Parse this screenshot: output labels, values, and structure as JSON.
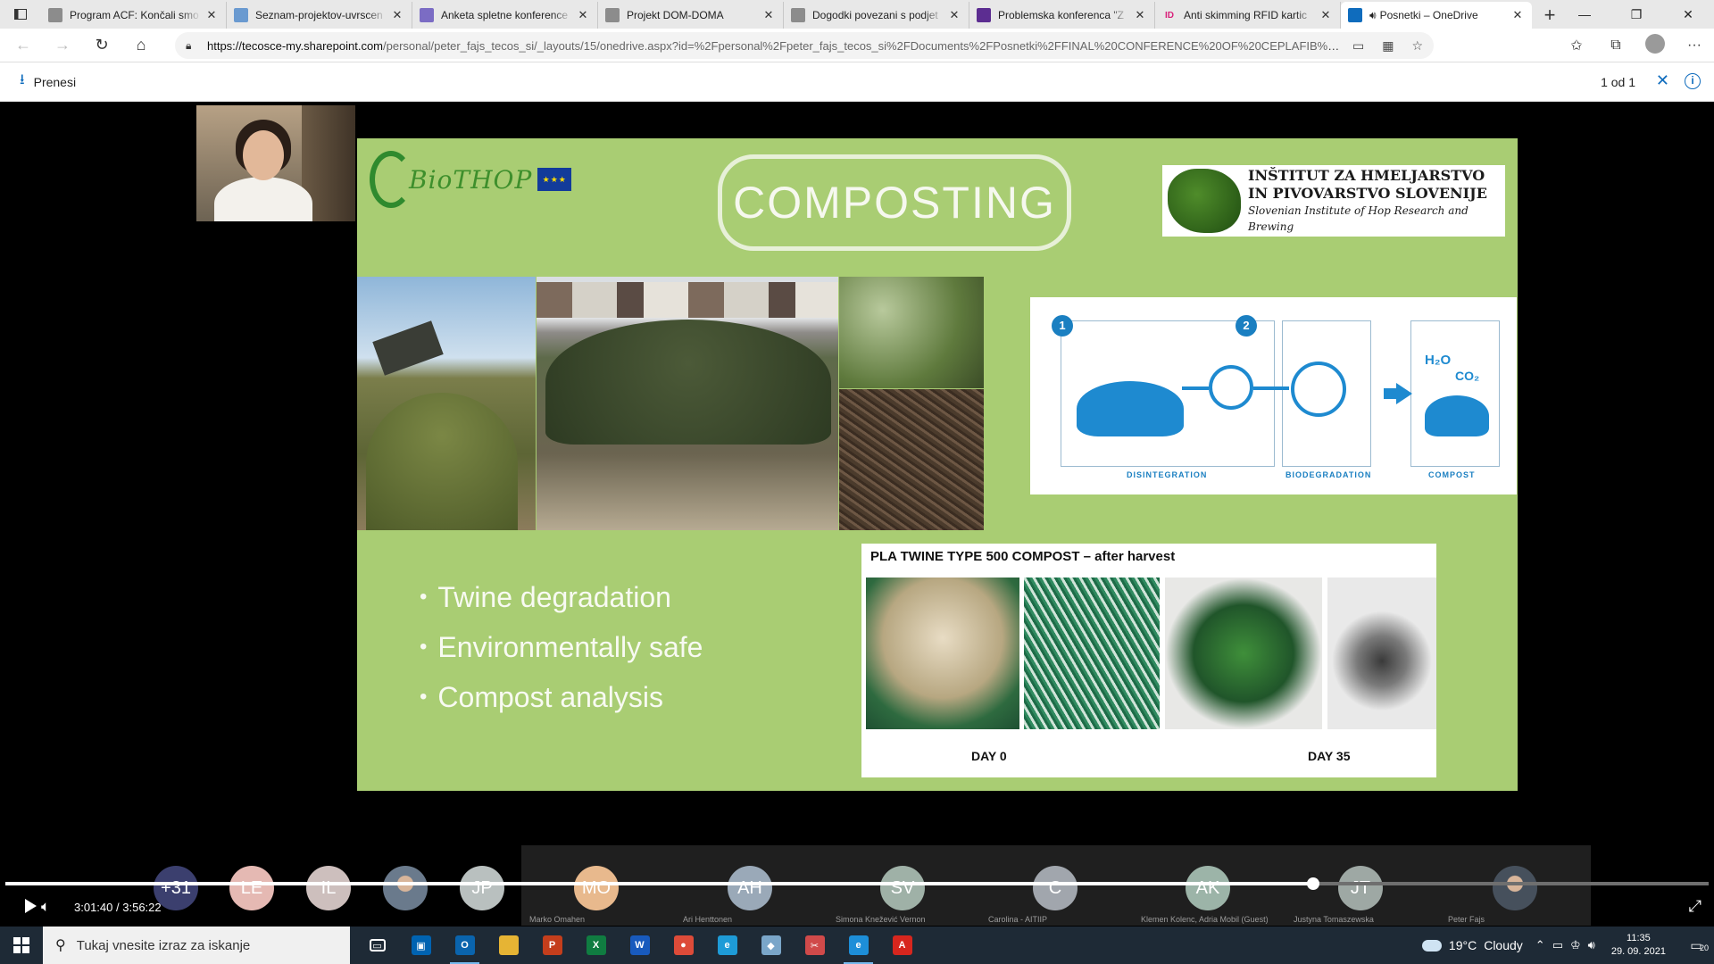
{
  "browser": {
    "tabs": [
      {
        "title": "Program ACF: Končali smo",
        "favicon_color": "#8c8c8c",
        "favicon": "page-icon"
      },
      {
        "title": "Seznam-projektov-uvrscen",
        "favicon_color": "#6a9ad0",
        "favicon": "doc-icon"
      },
      {
        "title": "Anketa spletne konference",
        "favicon_color": "#7b6cc4",
        "favicon": "form-icon"
      },
      {
        "title": "Projekt DOM-DOMA",
        "favicon_color": "#8c8c8c",
        "favicon": "page-icon"
      },
      {
        "title": "Dogodki povezani s podjet",
        "favicon_color": "#8c8c8c",
        "favicon": "image-icon"
      },
      {
        "title": "Problemska konferenca \"Z",
        "favicon_color": "#5c2d91",
        "favicon": "forms-icon"
      },
      {
        "title": "Anti skimming RFID kartic",
        "favicon_color": "#d9207a",
        "favicon": "id-icon",
        "favicon_text": "ID"
      },
      {
        "title": "Posnetki – OneDrive",
        "favicon_color": "#0f6cbd",
        "favicon": "onedrive-icon",
        "active": true
      }
    ],
    "url_host": "https://tecosce-my.sharepoint.com",
    "url_rest": "/personal/peter_fajs_tecos_si/_layouts/15/onedrive.aspx?id=%2Fpersonal%2Fpeter_fajs_tecos_si%2FDocuments%2FPosnetki%2FFINAL%20CONFERENCE%20OF%20CEPLAFIB%20PROJECT-..."
  },
  "onedrive": {
    "download_label": "Prenesi",
    "page_count": "1 od 1"
  },
  "slide": {
    "logo_text": "BioTHOP",
    "title": "COMPOSTING",
    "institute_line1": "INŠTITUT ZA HMELJARSTVO",
    "institute_line2": "IN PIVOVARSTVO SLOVENIJE",
    "institute_line3": "Slovenian Institute of Hop Research and Brewing",
    "diagram": {
      "step1": "1",
      "step2": "2",
      "h2o": "H₂O",
      "co2": "CO₂",
      "label_disintegration": "DISINTEGRATION",
      "label_biodegradation": "BIODEGRADATION",
      "label_compost": "COMPOST"
    },
    "bullets": [
      "Twine degradation",
      "Environmentally safe",
      "Compost analysis"
    ],
    "twine_heading": "PLA TWINE TYPE 500 COMPOST – after harvest",
    "day_start": "DAY 0",
    "day_end": "DAY 35"
  },
  "participants": [
    {
      "initials": "+31",
      "name": "",
      "color": "#3b3f6e"
    },
    {
      "initials": "LE",
      "name": "",
      "color": "#e5b9b3"
    },
    {
      "initials": "IL",
      "name": "",
      "color": "#cdbfbd"
    },
    {
      "initials": "",
      "name": "",
      "color": "#6a7a8c",
      "photo": true
    },
    {
      "initials": "JP",
      "name": "",
      "color": "#b9c0bf"
    },
    {
      "initials": "MO",
      "name": "Marko Omahen",
      "color": "#e8b98d"
    },
    {
      "initials": "AH",
      "name": "Ari Henttonen",
      "color": "#9aa9b8"
    },
    {
      "initials": "SV",
      "name": "Simona Knežević Vernon",
      "color": "#9fb1a7"
    },
    {
      "initials": "C",
      "name": "Carolina - AITIIP",
      "color": "#a1a6ad"
    },
    {
      "initials": "AK",
      "name": "Klemen Kolenc, Adria Mobil (Guest)",
      "color": "#9cb4a8"
    },
    {
      "initials": "JT",
      "name": "Justyna Tomaszewska",
      "color": "#9ea8a4"
    },
    {
      "initials": "",
      "name": "Peter Fajs",
      "color": "#46505c",
      "photo": true
    }
  ],
  "player": {
    "current_time": "3:01:40",
    "separator": "/",
    "total_time": "3:56:22",
    "progress": 0.768
  },
  "taskbar": {
    "search_placeholder": "Tukaj vnesite izraz za iskanje",
    "apps": [
      {
        "name": "task-view-icon",
        "color": "transparent",
        "glyph": "▭"
      },
      {
        "name": "store-icon",
        "color": "#0063b1",
        "glyph": "▣"
      },
      {
        "name": "outlook-icon",
        "color": "#0a64ad",
        "glyph": "O",
        "active": true
      },
      {
        "name": "explorer-icon",
        "color": "#e6b434",
        "glyph": ""
      },
      {
        "name": "powerpoint-icon",
        "color": "#c43e1c",
        "glyph": "P"
      },
      {
        "name": "excel-icon",
        "color": "#107c41",
        "glyph": "X"
      },
      {
        "name": "word-icon",
        "color": "#185abd",
        "glyph": "W"
      },
      {
        "name": "chrome-icon",
        "color": "#dd4b39",
        "glyph": "●"
      },
      {
        "name": "ie-icon",
        "color": "#1e9bd7",
        "glyph": "e"
      },
      {
        "name": "security-icon",
        "color": "#7aa6c9",
        "glyph": "◆"
      },
      {
        "name": "snip-icon",
        "color": "#d04a4a",
        "glyph": "✂"
      },
      {
        "name": "edge-icon",
        "color": "#1d8ed8",
        "glyph": "e",
        "active": true
      },
      {
        "name": "acrobat-icon",
        "color": "#d7261e",
        "glyph": "A"
      }
    ],
    "weather_temp": "19°C",
    "weather_text": "Cloudy",
    "time": "11:35",
    "date": "29. 09. 2021",
    "notification_count": "20"
  }
}
